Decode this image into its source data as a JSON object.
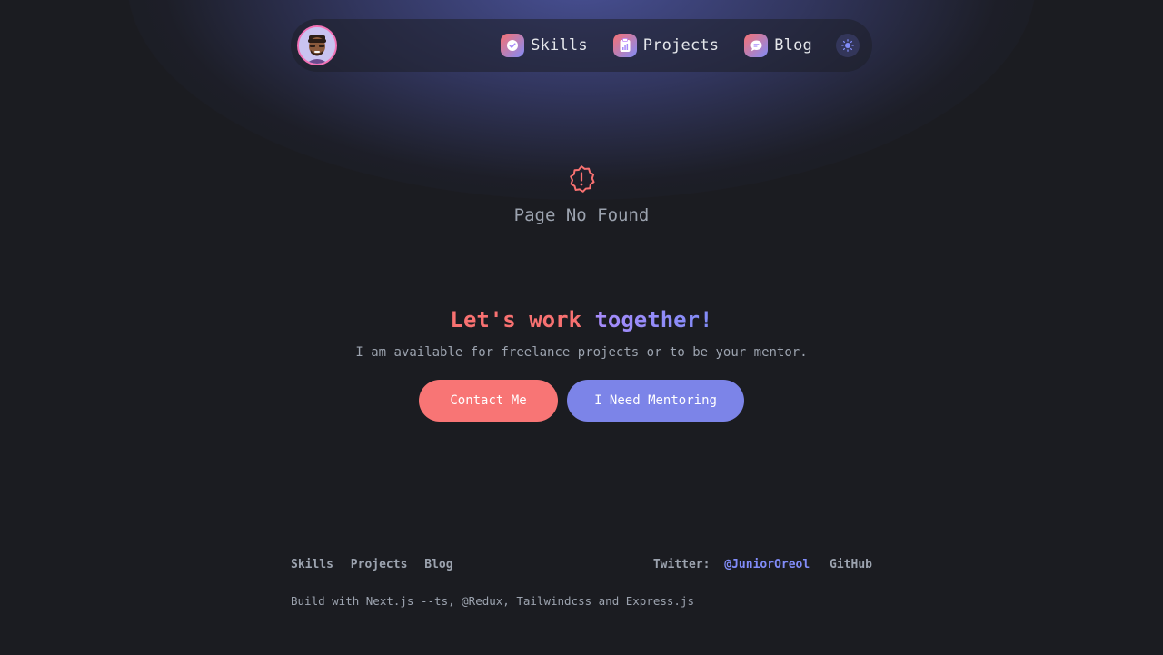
{
  "nav": {
    "items": [
      {
        "label": "Skills",
        "icon": "badge-check-icon"
      },
      {
        "label": "Projects",
        "icon": "clipboard-chart-icon"
      },
      {
        "label": "Blog",
        "icon": "chat-bubble-icon"
      }
    ],
    "theme_toggle_icon": "sun-icon",
    "avatar_icon": "memoji-avatar"
  },
  "not_found": {
    "icon": "exclamation-badge-icon",
    "text": "Page No Found"
  },
  "cta": {
    "title_part1": "Let's work",
    "title_part2": "together!",
    "subtitle": "I am available for freelance projects or to be your mentor.",
    "contact_label": "Contact Me",
    "mentor_label": "I Need Mentoring"
  },
  "footer": {
    "links": [
      "Skills",
      "Projects",
      "Blog"
    ],
    "twitter_label": "Twitter:",
    "twitter_handle": "@JuniorOreol",
    "github_label": "GitHub",
    "credit": "Build with Next.js --ts, @Redux, Tailwindcss and Express.js"
  },
  "colors": {
    "background": "#1b1c21",
    "accent_red": "#f87575",
    "accent_indigo": "#7c84e8"
  }
}
